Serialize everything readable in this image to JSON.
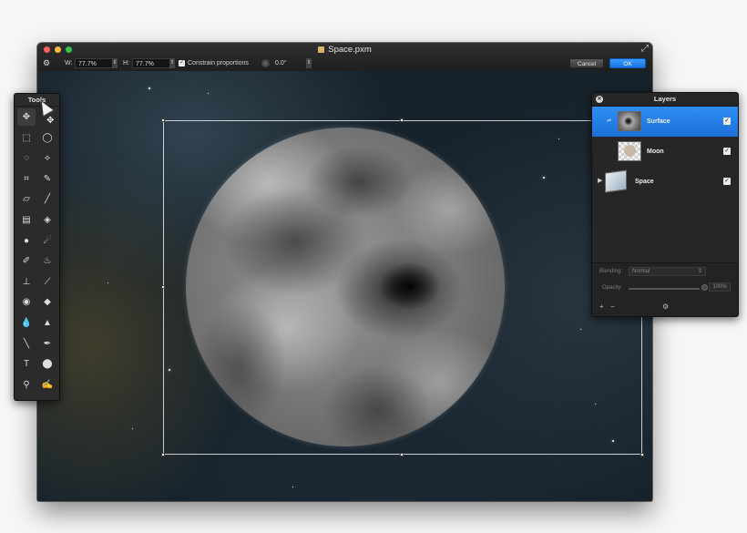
{
  "window": {
    "title": "Space.pxm",
    "expand_icon": "fullscreen-arrows-icon"
  },
  "options": {
    "width_label": "W:",
    "width_value": "77.7%",
    "height_label": "H:",
    "height_value": "77.7%",
    "constrain_label": "Constrain proportions",
    "constrain_checked": true,
    "rotation_value": "0.0°",
    "cancel_label": "Cancel",
    "ok_label": "OK"
  },
  "tools": {
    "title": "Tools",
    "items": [
      {
        "name": "arrange-tool",
        "glyph": "✥"
      },
      {
        "name": "rectangular-select-tool",
        "glyph": "⬚"
      },
      {
        "name": "elliptical-select-tool",
        "glyph": "◯"
      },
      {
        "name": "lasso-tool",
        "glyph": "◌"
      },
      {
        "name": "polygonal-lasso-tool",
        "glyph": "⟡"
      },
      {
        "name": "crop-tool",
        "glyph": "⌗"
      },
      {
        "name": "eyedropper-tool",
        "glyph": "✎"
      },
      {
        "name": "eraser-tool",
        "glyph": "▱"
      },
      {
        "name": "pencil-tool",
        "glyph": "╱"
      },
      {
        "name": "gradient-tool",
        "glyph": "▤"
      },
      {
        "name": "fill-tool",
        "glyph": "◈"
      },
      {
        "name": "blur-tool",
        "glyph": "●"
      },
      {
        "name": "smudge-tool",
        "glyph": "☄"
      },
      {
        "name": "brush-tool",
        "glyph": "✐"
      },
      {
        "name": "burn-tool",
        "glyph": "♨"
      },
      {
        "name": "clone-stamp-tool",
        "glyph": "⊥"
      },
      {
        "name": "healing-tool",
        "glyph": "⟋"
      },
      {
        "name": "red-eye-tool",
        "glyph": "◉"
      },
      {
        "name": "sponge-tool",
        "glyph": "◆"
      },
      {
        "name": "sharpen-tool",
        "glyph": "💧"
      },
      {
        "name": "dodge-tool",
        "glyph": "▲"
      },
      {
        "name": "pen-tool",
        "glyph": "╲"
      },
      {
        "name": "freeform-pen-tool",
        "glyph": "✒"
      },
      {
        "name": "type-tool",
        "glyph": "T"
      },
      {
        "name": "shape-tool",
        "glyph": "⬤"
      },
      {
        "name": "zoom-tool",
        "glyph": "⚲"
      },
      {
        "name": "paint-brush-tool",
        "glyph": "✍"
      }
    ]
  },
  "layers": {
    "title": "Layers",
    "items": [
      {
        "name": "Surface",
        "visible": true,
        "selected": true
      },
      {
        "name": "Moon",
        "visible": true,
        "selected": false
      },
      {
        "name": "Space",
        "visible": true,
        "selected": false
      }
    ],
    "blending_label": "Blending:",
    "blending_value": "Normal",
    "opacity_label": "Opacity:",
    "opacity_value": "100%",
    "opacity_fraction": 1.0
  },
  "colors": {
    "accent": "#2f8ef5",
    "ok_button": "#1a72df"
  }
}
